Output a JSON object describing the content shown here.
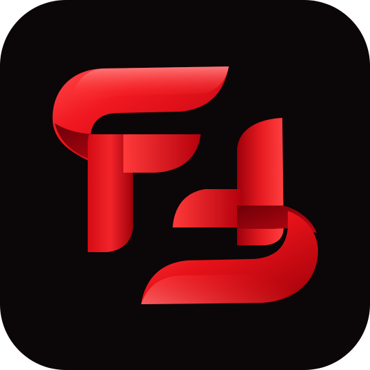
{
  "app_icon": {
    "background_color": "#0b0607",
    "accent_color": "#e0141c",
    "highlight_color": "#ff6a6a",
    "shadow_color": "#7a0008",
    "logo_icon": "ribbon-monogram-icon"
  }
}
